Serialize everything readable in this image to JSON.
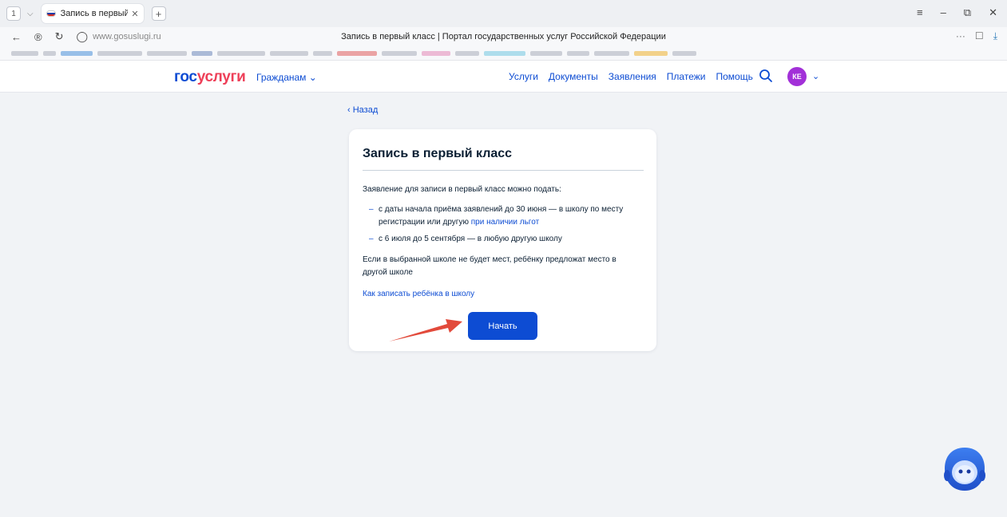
{
  "browser": {
    "tab_counter": "1",
    "tab_title": "Запись в первый класс",
    "url": "www.gosuslugi.ru",
    "page_title": "Запись в первый класс | Портал государственных услуг Российской Федерации"
  },
  "header": {
    "logo_gos": "гос",
    "logo_uslugi": "услуги",
    "citizens": "Гражданам",
    "nav": [
      "Услуги",
      "Документы",
      "Заявления",
      "Платежи",
      "Помощь"
    ],
    "avatar_initials": "КЕ"
  },
  "content": {
    "back": "Назад",
    "title": "Запись в первый класс",
    "intro": "Заявление для записи в первый класс можно подать:",
    "bullet1_text": "с даты начала приёма заявлений до 30 июня — в школу по месту регистрации или другую",
    "bullet1_link": "при наличии льгот",
    "bullet2_text": "с 6 июля до 5 сентября — в любую другую школу",
    "dash": "–",
    "note": "Если в выбранной школе не будет мест, ребёнку предложат место в другой школе",
    "how_link": "Как записать ребёнка в школу",
    "start_button": "Начать"
  },
  "colors": {
    "primary": "#0d4cd3",
    "logo_red": "#ee3f58",
    "arrow": "#e24a3b",
    "avatar": "#a230d8"
  }
}
